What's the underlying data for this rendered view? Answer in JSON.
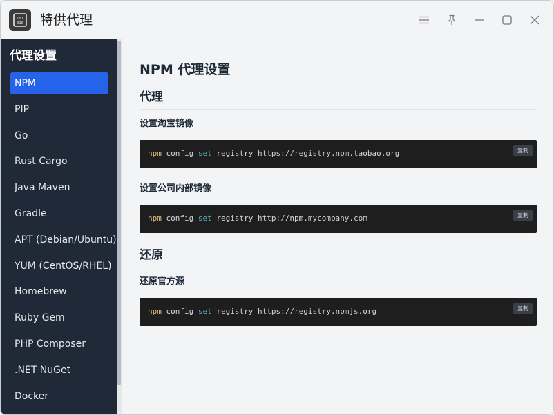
{
  "window": {
    "title": "特供代理",
    "controls": [
      "menu-icon",
      "pin-icon",
      "minimize-icon",
      "maximize-icon",
      "close-icon"
    ]
  },
  "sidebar": {
    "heading": "代理设置",
    "items": [
      {
        "label": "NPM",
        "active": true
      },
      {
        "label": "PIP",
        "active": false
      },
      {
        "label": "Go",
        "active": false
      },
      {
        "label": "Rust Cargo",
        "active": false
      },
      {
        "label": "Java Maven",
        "active": false
      },
      {
        "label": "Gradle",
        "active": false
      },
      {
        "label": "APT (Debian/Ubuntu)",
        "active": false
      },
      {
        "label": "YUM (CentOS/RHEL)",
        "active": false
      },
      {
        "label": "Homebrew",
        "active": false
      },
      {
        "label": "Ruby Gem",
        "active": false
      },
      {
        "label": "PHP Composer",
        "active": false
      },
      {
        "label": ".NET NuGet",
        "active": false
      },
      {
        "label": "Docker",
        "active": false
      }
    ]
  },
  "main": {
    "title": "NPM 代理设置",
    "sections": [
      {
        "title": "代理",
        "blocks": [
          {
            "label": "设置淘宝镜像",
            "cmd": "npm",
            "arg1": "config",
            "kw": "set",
            "rest": "registry https://registry.npm.taobao.org",
            "copy": "复制"
          },
          {
            "label": "设置公司内部镜像",
            "cmd": "npm",
            "arg1": "config",
            "kw": "set",
            "rest": "registry http://npm.mycompany.com",
            "copy": "复制"
          }
        ]
      },
      {
        "title": "还原",
        "blocks": [
          {
            "label": "还原官方源",
            "cmd": "npm",
            "arg1": "config",
            "kw": "set",
            "rest": "registry https://registry.npmjs.org",
            "copy": "复制"
          }
        ]
      }
    ]
  },
  "colors": {
    "sidebar_bg": "#1f2937",
    "accent": "#2563eb",
    "code_bg": "#1e1e1e",
    "code_cmd": "#e5c07b",
    "code_kw": "#56b6c2"
  }
}
